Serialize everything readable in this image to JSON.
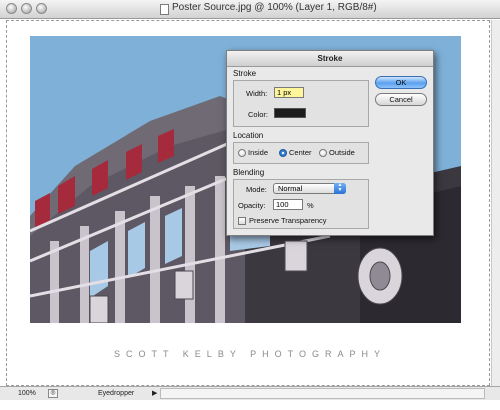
{
  "window": {
    "title": "Poster Source.jpg @ 100% (Layer 1, RGB/8#)"
  },
  "caption": "SCOTT KELBY PHOTOGRAPHY",
  "statusbar": {
    "zoom": "100%",
    "tool": "Eyedropper"
  },
  "dialog": {
    "title": "Stroke",
    "stroke_group": "Stroke",
    "width_label": "Width:",
    "width_value": "1 px",
    "color_label": "Color:",
    "color_value": "#1c1c1c",
    "location_group": "Location",
    "location_options": [
      "Inside",
      "Center",
      "Outside"
    ],
    "location_selected": "Center",
    "blending_group": "Blending",
    "mode_label": "Mode:",
    "mode_value": "Normal",
    "opacity_label": "Opacity:",
    "opacity_value": "100",
    "opacity_unit": "%",
    "preserve_label": "Preserve Transparency",
    "preserve_checked": false,
    "ok_label": "OK",
    "cancel_label": "Cancel"
  },
  "colors": {
    "sky": "#7fb1d8",
    "accent_blue": "#3b8de0"
  }
}
